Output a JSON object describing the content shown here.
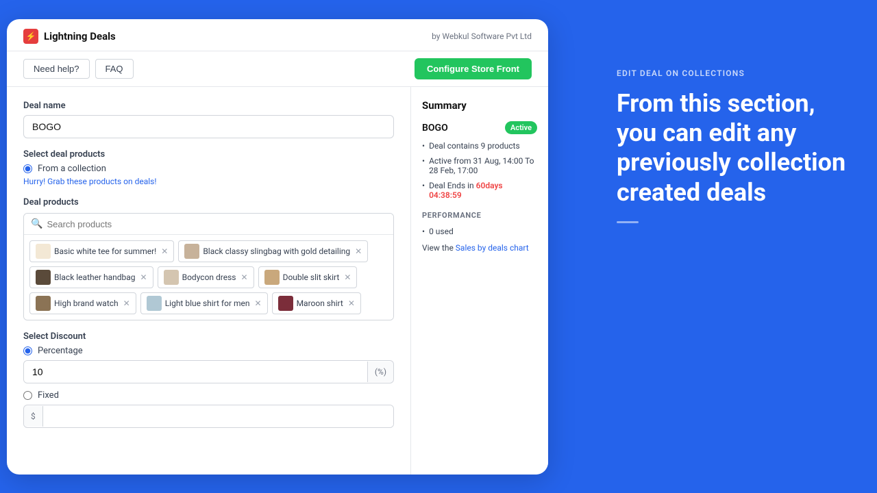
{
  "app": {
    "logo_label": "Lightning Deals",
    "subtitle": "by Webkul Software Pvt Ltd",
    "logo_icon": "⚡"
  },
  "nav": {
    "help_btn": "Need help?",
    "faq_btn": "FAQ",
    "configure_btn": "Configure Store Front"
  },
  "form": {
    "deal_name_label": "Deal name",
    "deal_name_value": "BOGO",
    "select_products_label": "Select deal products",
    "from_collection_label": "From a collection",
    "promo_text": "Hurry! Grab these products on deals!",
    "deal_products_label": "Deal products",
    "search_placeholder": "Search products",
    "discount_label": "Select Discount",
    "percentage_label": "Percentage",
    "percentage_value": "10",
    "percentage_suffix": "(%)",
    "fixed_label": "Fixed",
    "fixed_prefix": "$",
    "fixed_value": ""
  },
  "products": [
    {
      "name": "Basic white tee for summer!",
      "thumb_color": "#f3e8d5"
    },
    {
      "name": "Black classy slingbag with gold detailing",
      "thumb_color": "#c7b29a"
    },
    {
      "name": "Black leather handbag",
      "thumb_color": "#5a4a3a"
    },
    {
      "name": "Bodycon dress",
      "thumb_color": "#d4c5b0"
    },
    {
      "name": "Double slit skirt",
      "thumb_color": "#c9a87c"
    },
    {
      "name": "High brand watch",
      "thumb_color": "#8b7355"
    },
    {
      "name": "Light blue shirt for men",
      "thumb_color": "#b0c8d4"
    },
    {
      "name": "Maroon shirt",
      "thumb_color": "#7b2d3a"
    }
  ],
  "summary": {
    "title": "Summary",
    "deal_name": "BOGO",
    "status": "Active",
    "items": [
      "Deal contains 9 products",
      "Active from 31 Aug, 14:00 To 28 Feb, 17:00",
      "Deal Ends in 60days 04:38:59"
    ],
    "ends_label": "Deal Ends in ",
    "ends_highlight": "60days 04:38:59",
    "perf_title": "PERFORMANCE",
    "perf_items": [
      "0 used"
    ],
    "view_chart_prefix": "View the ",
    "view_chart_link": "Sales by deals chart"
  },
  "info_panel": {
    "subtitle": "EDIT DEAL ON COLLECTIONS",
    "headline": "From this section, you can edit any previously collection created deals"
  }
}
